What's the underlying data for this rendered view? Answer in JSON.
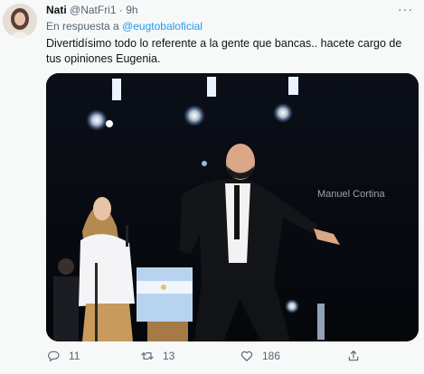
{
  "tweet": {
    "author_name": "Nati",
    "author_handle": "@NatFri1",
    "separator": "·",
    "time": "9h",
    "reply_prefix": "En respuesta a",
    "reply_mention": "@eugtobaloficial",
    "text": "Divertidísimo todo lo referente a la gente que bancas.. hacete cargo de tus opiniones Eugenia.",
    "more_glyph": "···",
    "media_watermark": "Manuel Cortina"
  },
  "actions": {
    "replies": "11",
    "retweets": "13",
    "likes": "186"
  },
  "colors": {
    "accent": "#1d9bf0",
    "muted": "#536471",
    "text": "#0f1419"
  },
  "icons": [
    "more-icon",
    "reply-icon",
    "retweet-icon",
    "like-icon",
    "share-icon"
  ]
}
